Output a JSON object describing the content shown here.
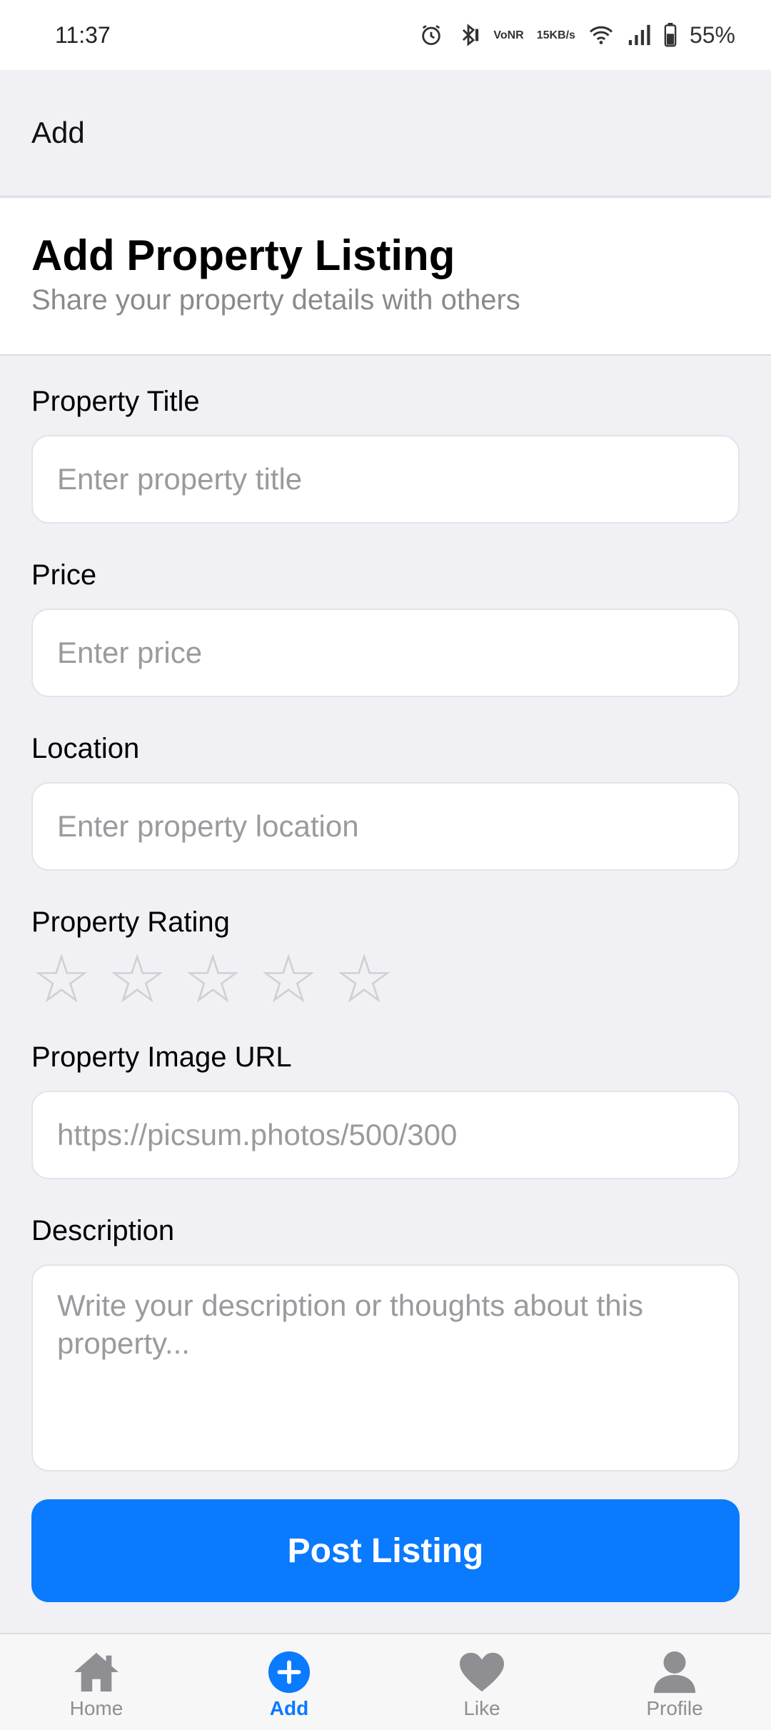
{
  "status_bar": {
    "time": "11:37",
    "network_speed_value": "15",
    "network_speed_unit": "KB/s",
    "volte_top": "Vo",
    "volte_bottom": "NR",
    "battery": "55%"
  },
  "app_bar": {
    "title": "Add"
  },
  "header": {
    "title": "Add Property Listing",
    "subtitle": "Share your property details with others"
  },
  "form": {
    "title": {
      "label": "Property Title",
      "placeholder": "Enter property title",
      "value": ""
    },
    "price": {
      "label": "Price",
      "placeholder": "Enter price",
      "value": ""
    },
    "location": {
      "label": "Location",
      "placeholder": "Enter property location",
      "value": ""
    },
    "rating": {
      "label": "Property Rating",
      "max": 5,
      "value": 0
    },
    "image_url": {
      "label": "Property Image URL",
      "placeholder": "https://picsum.photos/500/300",
      "value": ""
    },
    "description": {
      "label": "Description",
      "placeholder": "Write your description or thoughts about this property...",
      "value": ""
    }
  },
  "post_button": {
    "label": "Post Listing"
  },
  "tabs": [
    {
      "label": "Home",
      "icon": "home-icon",
      "active": false
    },
    {
      "label": "Add",
      "icon": "add-circle-icon",
      "active": true
    },
    {
      "label": "Like",
      "icon": "heart-icon",
      "active": false
    },
    {
      "label": "Profile",
      "icon": "person-icon",
      "active": false
    }
  ],
  "colors": {
    "accent": "#0a7aff",
    "inactive_tab": "#8e8e93",
    "star_empty": "#cfcfd4"
  }
}
